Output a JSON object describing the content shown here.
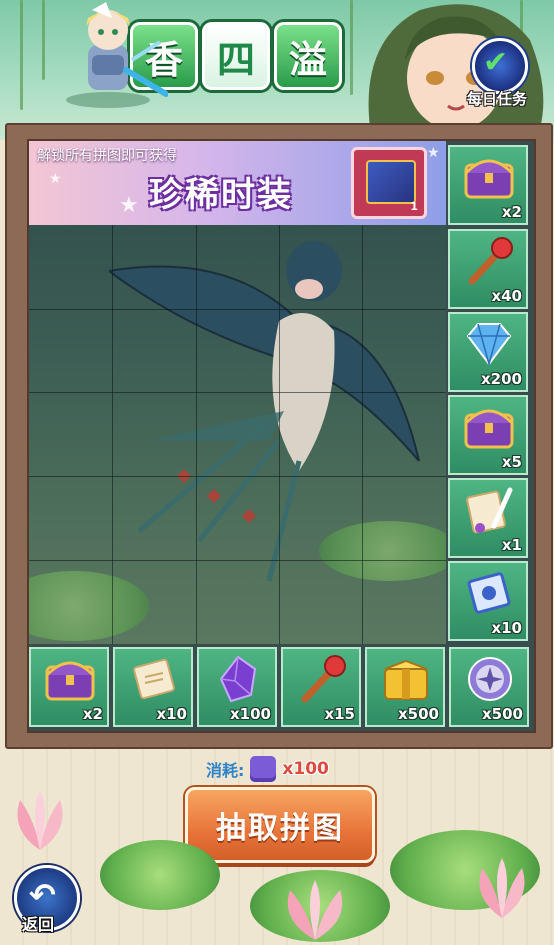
{
  "header": {
    "title_glyphs": [
      "香",
      "四",
      "溢"
    ],
    "daily_task_label": "每日任务"
  },
  "banner": {
    "subtitle": "解锁所有拼图即可获得",
    "title": "珍稀时装",
    "reward_count": "1",
    "reward_icon": "costume-chest-icon"
  },
  "puzzle": {
    "columns": 5,
    "rows": 5,
    "image": "swallow-kite-over-lotus-pond"
  },
  "side_rewards": [
    {
      "icon": "purple-chest-icon",
      "qty": "x2"
    },
    {
      "icon": "red-scepter-icon",
      "qty": "x40"
    },
    {
      "icon": "blue-diamond-icon",
      "qty": "x200"
    },
    {
      "icon": "purple-chest-icon",
      "qty": "x5"
    },
    {
      "icon": "scroll-quill-icon",
      "qty": "x1"
    },
    {
      "icon": "blue-scroll-icon",
      "qty": "x10"
    }
  ],
  "bottom_rewards": [
    {
      "icon": "purple-chest-icon",
      "qty": "x2"
    },
    {
      "icon": "parchment-scroll-icon",
      "qty": "x10"
    },
    {
      "icon": "purple-crystal-icon",
      "qty": "x100"
    },
    {
      "icon": "red-scepter-icon",
      "qty": "x15"
    },
    {
      "icon": "gold-chest-icon",
      "qty": "x500"
    },
    {
      "icon": "saw-blade-icon",
      "qty": "x500"
    }
  ],
  "cost": {
    "label": "消耗:",
    "icon": "puzzle-piece-icon",
    "amount": "x100"
  },
  "draw_button_label": "抽取拼图",
  "back_label": "返回",
  "colors": {
    "tile_green": "#3fa073",
    "button_orange": "#e8743a",
    "frame_wood": "#8c6a55",
    "banner_purple": "#6d2fa0"
  }
}
